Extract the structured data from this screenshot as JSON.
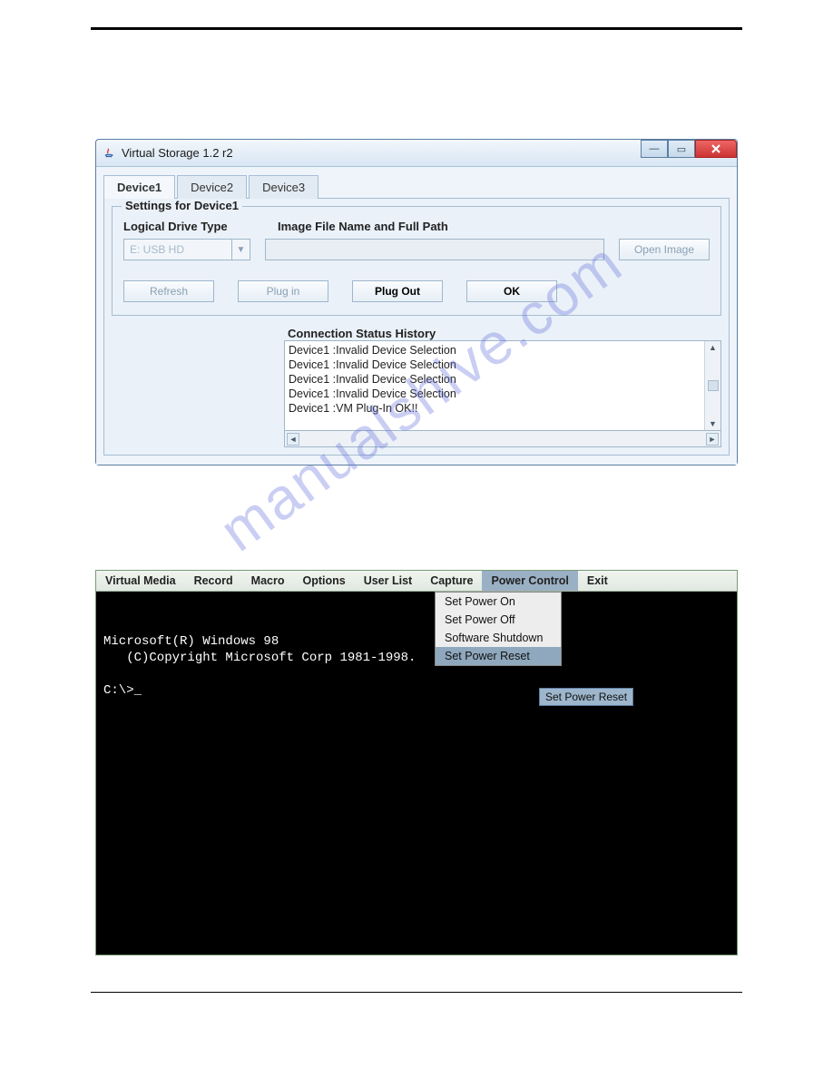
{
  "window1": {
    "title": "Virtual Storage 1.2 r2",
    "tabs": [
      "Device1",
      "Device2",
      "Device3"
    ],
    "active_tab": 0,
    "group_title": "Settings for Device1",
    "labels": {
      "drive_type": "Logical Drive Type",
      "image_path": "Image File Name and Full Path"
    },
    "drive_value": "E: USB HD",
    "buttons": {
      "open_image": "Open Image",
      "refresh": "Refresh",
      "plug_in": "Plug in",
      "plug_out": "Plug Out",
      "ok": "OK"
    },
    "history": {
      "title": "Connection Status History",
      "lines": [
        "Device1 :Invalid Device Selection",
        "Device1 :Invalid Device Selection",
        "Device1 :Invalid Device Selection",
        "Device1 :Invalid Device Selection",
        "Device1 :VM Plug-In OK!!"
      ]
    }
  },
  "window2": {
    "menubar": [
      "Virtual Media",
      "Record",
      "Macro",
      "Options",
      "User List",
      "Capture",
      "Power Control",
      "Exit"
    ],
    "active_menu_index": 6,
    "dropdown": [
      "Set Power On",
      "Set Power Off",
      "Software Shutdown",
      "Set Power Reset"
    ],
    "dropdown_highlight_index": 3,
    "tooltip": "Set Power Reset",
    "console_lines": [
      "Microsoft(R) Windows 98",
      "   (C)Copyright Microsoft Corp 1981-1998.",
      "",
      "C:\\>_"
    ]
  },
  "watermark": "manualshive.com"
}
